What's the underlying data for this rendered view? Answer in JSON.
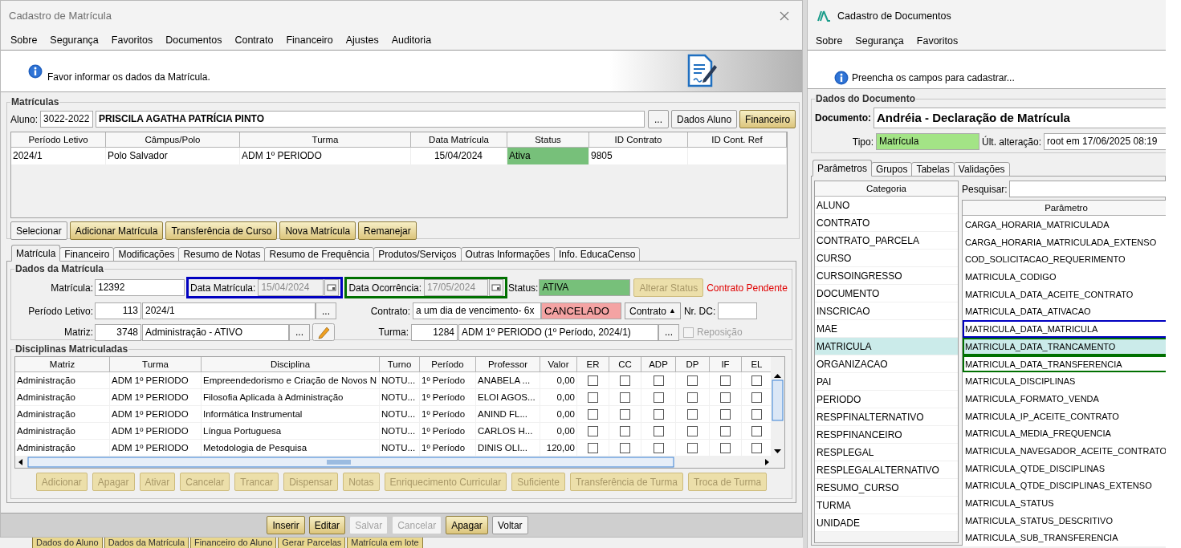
{
  "left_window": {
    "title": "Cadastro de Matrícula",
    "menu": [
      "Sobre",
      "Segurança",
      "Favoritos",
      "Documentos",
      "Contrato",
      "Financeiro",
      "Ajustes",
      "Auditoria"
    ],
    "info": "Favor informar os dados da Matrícula.",
    "matriculas": {
      "title": "Matrículas",
      "aluno_label": "Aluno:",
      "aluno_code": "3022-2022",
      "aluno_name": "PRISCILA AGATHA PATRÍCIA PINTO",
      "aluno_buttons": [
        {
          "label": "...",
          "kind": "plain"
        },
        {
          "label": "Dados Aluno",
          "kind": "plain"
        },
        {
          "label": "Financeiro",
          "kind": "gold"
        }
      ],
      "table": {
        "columns": [
          "Período Letivo",
          "Câmpus/Polo",
          "Turma",
          "Data Matrícula",
          "Status",
          "ID Contrato",
          "ID Cont. Ref"
        ],
        "rows": [
          {
            "cells": [
              "2024/1",
              "Polo Salvador",
              "ADM 1º PERIODO",
              "15/04/2024",
              "Ativa",
              "9805"
            ],
            "color": "#77c07a"
          }
        ]
      },
      "buttons": [
        {
          "label": "Selecionar",
          "kind": "plain"
        },
        {
          "label": "Adicionar Matrícula",
          "kind": "gold"
        },
        {
          "label": "Transferência de Curso",
          "kind": "gold"
        },
        {
          "label": "Nova Matrícula",
          "kind": "gold"
        },
        {
          "label": "Remanejar",
          "kind": "gold"
        }
      ]
    },
    "tabs": [
      {
        "label": "Matrícula",
        "selected": true
      },
      {
        "label": "Financeiro",
        "selected": false
      },
      {
        "label": "Modificações",
        "selected": false
      },
      {
        "label": "Resumo de Notas",
        "selected": false
      },
      {
        "label": "Resumo de Frequência",
        "selected": false
      },
      {
        "label": "Produtos/Serviços",
        "selected": false
      },
      {
        "label": "Outras Informações",
        "selected": false
      },
      {
        "label": "Info. EducaCenso",
        "selected": false
      }
    ],
    "dados": {
      "title": "Dados da Matrícula",
      "matricula": {
        "label": "Matrícula:",
        "value": "12392"
      },
      "data_matricula": {
        "label": "Data Matrícula:",
        "value": "15/04/2024",
        "disabled": true,
        "color": "#0000c0"
      },
      "data_ocorrencia": {
        "label": "Data Ocorrência:",
        "value": "17/05/2024",
        "disabled": true,
        "color": "#007000"
      },
      "status": {
        "label": "Status:",
        "value": "ATIVA",
        "color": "#77c07a"
      },
      "alterar_status": {
        "label": "Alterar Status",
        "kind": "gold",
        "disabled": true
      },
      "alert": "Contrato Pendente",
      "periodo": {
        "label": "Período Letivo:",
        "code": "113",
        "value": "2024/1",
        "lookup": "..."
      },
      "contrato": {
        "label": "Contrato:",
        "value": "a um dia de vencimento- 6x",
        "state": {
          "label": "CANCELADO",
          "color": "#f4a3a3"
        },
        "button": "Contrato",
        "button_glyph": "▲"
      },
      "nr_dc": {
        "label": "Nr. DC:"
      },
      "matriz": {
        "label": "Matriz:",
        "code": "3748",
        "value": "Administração - ATIVO",
        "lookup": "..."
      },
      "turma": {
        "label": "Turma:",
        "code": "1284",
        "value": "ADM 1º PERIODO (1º Período, 2024/1)",
        "lookup": "..."
      },
      "reposicao": {
        "label": "Reposição",
        "checked": false,
        "disabled": true
      }
    },
    "disciplinas": {
      "title": "Disciplinas Matriculadas",
      "columns": [
        "Matriz",
        "Turma",
        "Disciplina",
        "Turno",
        "Período",
        "Professor",
        "Valor",
        "ER",
        "CC",
        "ADP",
        "DP",
        "IF",
        "EL"
      ],
      "rows": [
        {
          "cells": [
            "Administração",
            "ADM 1º PERIODO",
            "Empreendedorismo e Criação de Novos N",
            "NOTU...",
            "1º Período",
            "ANABELA ...",
            "0,00"
          ],
          "checks": [
            false,
            false,
            false,
            false,
            false,
            false
          ]
        },
        {
          "cells": [
            "Administração",
            "ADM 1º PERIODO",
            "Filosofia Aplicada à Administração",
            "NOTU...",
            "1º Período",
            "ELOI AGOS...",
            "0,00"
          ],
          "checks": [
            false,
            false,
            false,
            false,
            false,
            false
          ]
        },
        {
          "cells": [
            "Administração",
            "ADM 1º PERIODO",
            "Informática Instrumental",
            "NOTU...",
            "1º Período",
            "ANIND FL...",
            "0,00"
          ],
          "checks": [
            false,
            false,
            false,
            false,
            false,
            false
          ]
        },
        {
          "cells": [
            "Administração",
            "ADM 1º PERIODO",
            "Língua Portuguesa",
            "NOTU...",
            "1º Período",
            "CARLOS H...",
            "0,00"
          ],
          "checks": [
            false,
            false,
            false,
            false,
            false,
            false
          ]
        },
        {
          "cells": [
            "Administração",
            "ADM 1º PERIODO",
            "Metodologia de Pesquisa",
            "NOTU...",
            "1º Período",
            "DINIS OLI...",
            "120,00"
          ],
          "checks": [
            false,
            false,
            false,
            false,
            false,
            false
          ]
        }
      ],
      "buttons": [
        {
          "label": "Adicionar",
          "kind": "gold",
          "disabled": true
        },
        {
          "label": "Apagar",
          "kind": "gold",
          "disabled": true
        },
        {
          "label": "Ativar",
          "kind": "gold",
          "disabled": true
        },
        {
          "label": "Cancelar",
          "kind": "gold",
          "disabled": true
        },
        {
          "label": "Trancar",
          "kind": "gold",
          "disabled": true
        },
        {
          "label": "Dispensar",
          "kind": "gold",
          "disabled": true
        },
        {
          "label": "Notas",
          "kind": "gold",
          "disabled": true
        },
        {
          "label": "Enriquecimento Curricular",
          "kind": "gold",
          "disabled": true
        },
        {
          "label": "Suficiente",
          "kind": "gold",
          "disabled": true
        },
        {
          "label": "Transferência de Turma",
          "kind": "gold",
          "disabled": true
        },
        {
          "label": "Troca de Turma",
          "kind": "gold",
          "disabled": true
        }
      ]
    },
    "footer_buttons": [
      {
        "label": "Inserir",
        "kind": "gold",
        "disabled": false
      },
      {
        "label": "Editar",
        "kind": "gold",
        "disabled": false
      },
      {
        "label": "Salvar",
        "kind": "plain",
        "disabled": true
      },
      {
        "label": "Cancelar",
        "kind": "plain",
        "disabled": true
      },
      {
        "label": "Apagar",
        "kind": "gold",
        "disabled": false
      },
      {
        "label": "Voltar",
        "kind": "plain",
        "disabled": false
      }
    ]
  },
  "background_buttons": [
    "Dados do Aluno",
    "Dados da Matrícula",
    "Financeiro do Aluno",
    "Gerar Parcelas",
    "Matrícula em lote"
  ],
  "right_window": {
    "title": "Cadastro de Documentos",
    "menu": [
      "Sobre",
      "Segurança",
      "Favoritos"
    ],
    "info": "Preencha os campos para cadastrar...",
    "dados": {
      "title": "Dados do Documento",
      "documento_label": "Documento:",
      "documento": "Andréia - Declaração de Matrícula",
      "tipo_label": "Tipo:",
      "tipo": {
        "value": "Matrícula",
        "color": "#a3e486"
      },
      "alteracao_label": "Últ. alteração:",
      "alteracao": "root em 17/06/2025 08:19"
    },
    "tabs": [
      {
        "label": "Parâmetros",
        "selected": true
      },
      {
        "label": "Grupos",
        "selected": false
      },
      {
        "label": "Tabelas",
        "selected": false
      },
      {
        "label": "Validações",
        "selected": false
      }
    ],
    "categoria": {
      "column": "Categoria",
      "items": [
        {
          "label": "ALUNO",
          "selected": false
        },
        {
          "label": "CONTRATO",
          "selected": false
        },
        {
          "label": "CONTRATO_PARCELA",
          "selected": false
        },
        {
          "label": "CURSO",
          "selected": false
        },
        {
          "label": "CURSOINGRESSO",
          "selected": false
        },
        {
          "label": "DOCUMENTO",
          "selected": false
        },
        {
          "label": "INSCRICAO",
          "selected": false
        },
        {
          "label": "MAE",
          "selected": false
        },
        {
          "label": "MATRICULA",
          "selected": true
        },
        {
          "label": "ORGANIZACAO",
          "selected": false
        },
        {
          "label": "PAI",
          "selected": false
        },
        {
          "label": "PERIODO",
          "selected": false
        },
        {
          "label": "RESPFINALTERNATIVO",
          "selected": false
        },
        {
          "label": "RESPFINANCEIRO",
          "selected": false
        },
        {
          "label": "RESPLEGAL",
          "selected": false
        },
        {
          "label": "RESPLEGALALTERNATIVO",
          "selected": false
        },
        {
          "label": "RESUMO_CURSO",
          "selected": false
        },
        {
          "label": "TURMA",
          "selected": false
        },
        {
          "label": "UNIDADE",
          "selected": false
        }
      ]
    },
    "search_label": "Pesquisar:",
    "parametros": {
      "column": "Parâmetro",
      "items": [
        {
          "label": "CARGA_HORARIA_MATRICULADA",
          "selected": false
        },
        {
          "label": "CARGA_HORARIA_MATRICULADA_EXTENSO",
          "selected": false
        },
        {
          "label": "COD_SOLICITACAO_REQUERIMENTO",
          "selected": false
        },
        {
          "label": "MATRICULA_CODIGO",
          "selected": false
        },
        {
          "label": "MATRICULA_DATA_ACEITE_CONTRATO",
          "selected": false
        },
        {
          "label": "MATRICULA_DATA_ATIVACAO",
          "selected": false
        },
        {
          "label": "MATRICULA_DATA_MATRICULA",
          "selected": false,
          "color": "#0000c0"
        },
        {
          "label": "MATRICULA_DATA_TRANCAMENTO",
          "selected": true,
          "color": "#007000"
        },
        {
          "label": "MATRICULA_DATA_TRANSFERENCIA",
          "selected": false,
          "color": "#007000"
        },
        {
          "label": "MATRICULA_DISCIPLINAS",
          "selected": false
        },
        {
          "label": "MATRICULA_FORMATO_VENDA",
          "selected": false
        },
        {
          "label": "MATRICULA_IP_ACEITE_CONTRATO",
          "selected": false
        },
        {
          "label": "MATRICULA_MEDIA_FREQUENCIA",
          "selected": false
        },
        {
          "label": "MATRICULA_NAVEGADOR_ACEITE_CONTRATO",
          "selected": false
        },
        {
          "label": "MATRICULA_QTDE_DISCIPLINAS",
          "selected": false
        },
        {
          "label": "MATRICULA_QTDE_DISCIPLINAS_EXTENSO",
          "selected": false
        },
        {
          "label": "MATRICULA_STATUS",
          "selected": false
        },
        {
          "label": "MATRICULA_STATUS_DESCRITIVO",
          "selected": false
        },
        {
          "label": "MATRICULA_SUB_TRANSFERENCIA",
          "selected": false
        }
      ]
    }
  }
}
